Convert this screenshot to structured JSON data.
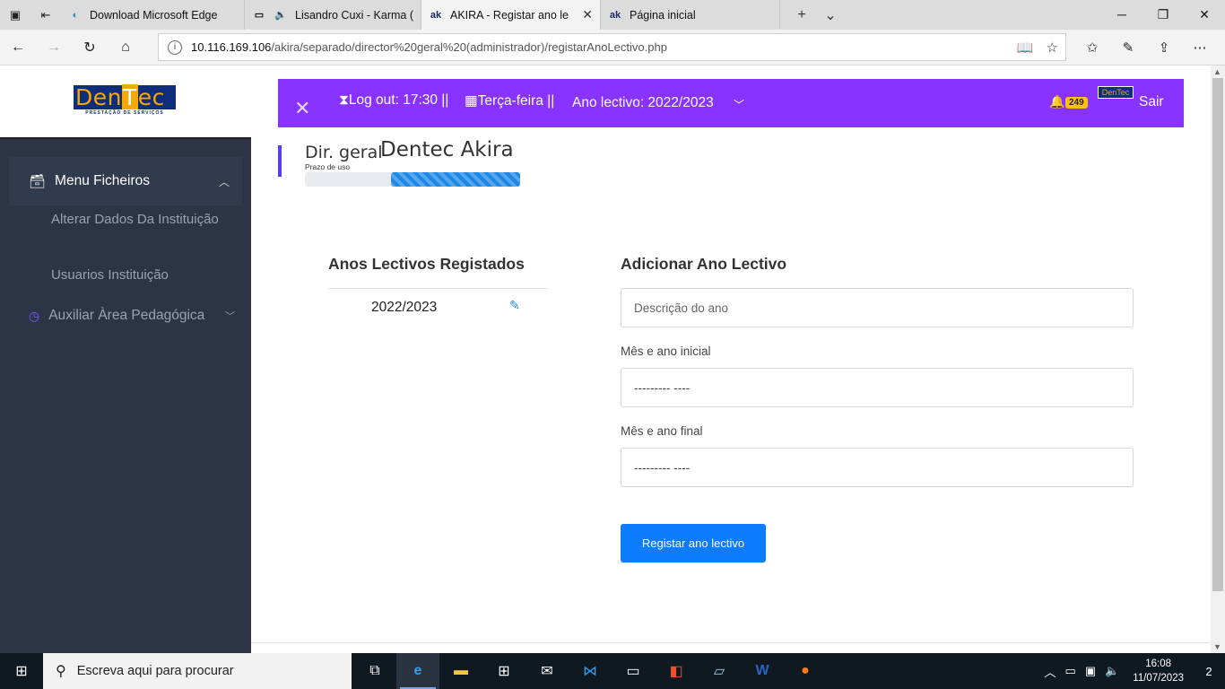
{
  "browser": {
    "tabs": [
      {
        "title": "Download Microsoft Edge",
        "icon": "edge-icon",
        "active": false
      },
      {
        "title": "Lisandro Cuxi - Karma (",
        "icon": "page-icon",
        "active": false
      },
      {
        "title": "AKIRA - Registar ano le",
        "icon": "ak-icon",
        "favicon_text": "ak",
        "active": true
      },
      {
        "title": "Página inicial",
        "icon": "ak-icon",
        "favicon_text": "ak",
        "active": false
      }
    ],
    "url_host": "10.116.169.106",
    "url_path": "/akira/separado/director%20geral%20(administrador)/registarAnoLectivo.php"
  },
  "sidebar": {
    "logo_main_pre": "Den",
    "logo_main_t": "T",
    "logo_main_post": "ec",
    "logo_sub": "PRESTAÇÃO DE SERVIÇOS",
    "menu_head": "Menu Ficheiros",
    "items": [
      "Alterar Dados Da Instituição",
      "Usuarios Instituição"
    ],
    "aux_menu": "Auxiliar Àrea Pedagógica"
  },
  "topbar": {
    "logout": "Log out: 17:30 ||",
    "day": "Terça-feira ||",
    "ano": "Ano lectivo: 2022/2023",
    "notifications": "249",
    "mini_logo": "DenTec",
    "sair": "Sair"
  },
  "header": {
    "role": "Dir. geral",
    "name": "Dentec Akira",
    "prazo_label": "Prazo de uso",
    "prazo_progress": 0.6
  },
  "left_panel": {
    "title": "Anos Lectivos Registados",
    "years": [
      "2022/2023"
    ]
  },
  "form": {
    "title": "Adicionar Ano Lectivo",
    "desc_placeholder": "Descrição do ano",
    "inicial_label": "Mês e ano inicial",
    "inicial_value": "--------- ----",
    "final_label": "Mês e ano final",
    "final_value": "--------- ----",
    "submit": "Registar ano lectivo"
  },
  "taskbar": {
    "search_placeholder": "Escreva aqui para procurar",
    "time": "16:08",
    "date": "11/07/2023",
    "notif_count": "2"
  },
  "colors": {
    "topbar": "#8833ff",
    "sidebar": "#2d3445",
    "button": "#0d7cff",
    "badge": "#ffc107"
  }
}
